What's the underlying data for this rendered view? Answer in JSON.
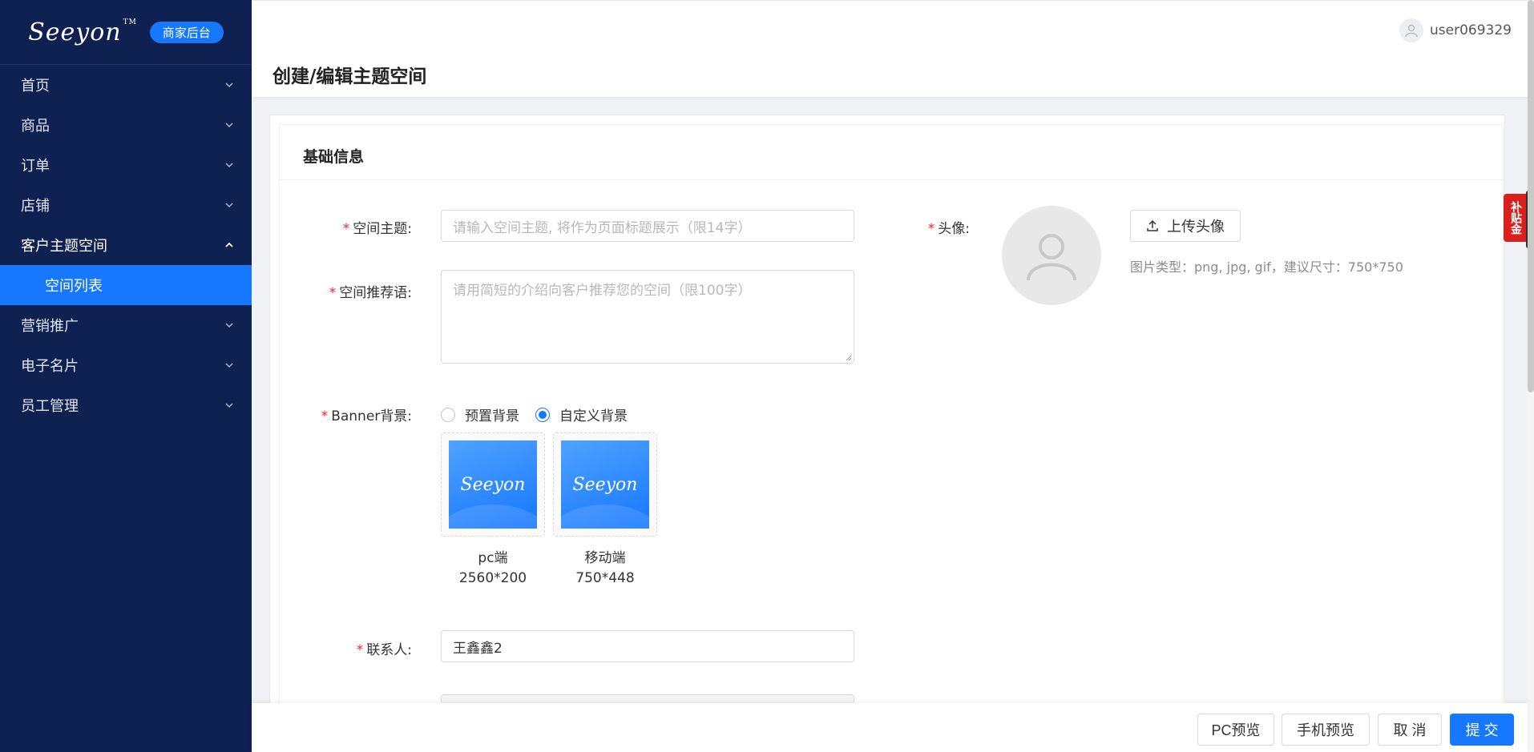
{
  "sidebar": {
    "logo": "Seeyon",
    "logo_tm": "TM",
    "badge": "商家后台",
    "items": [
      {
        "label": "首页"
      },
      {
        "label": "商品"
      },
      {
        "label": "订单"
      },
      {
        "label": "店铺"
      },
      {
        "label": "客户主题空间"
      },
      {
        "label": "营销推广"
      },
      {
        "label": "电子名片"
      },
      {
        "label": "员工管理"
      }
    ],
    "active_sub": "空间列表"
  },
  "header": {
    "title": "创建/编辑主题空间",
    "username": "user069329"
  },
  "side_tag": "补贴金",
  "form": {
    "section_title": "基础信息",
    "theme_label": "空间主题:",
    "theme_placeholder": "请输入空间主题, 将作为页面标题展示（限14字）",
    "recommend_label": "空间推荐语:",
    "recommend_placeholder": "请用简短的介绍向客户推荐您的空间（限100字）",
    "banner_label": "Banner背景:",
    "banner_options": [
      "预置背景",
      "自定义背景"
    ],
    "banner_selected": "自定义背景",
    "thumbs": [
      {
        "logo": "Seeyon",
        "name": "pc端",
        "size": "2560*200"
      },
      {
        "logo": "Seeyon",
        "name": "移动端",
        "size": "750*448"
      }
    ],
    "contact_label": "联系人:",
    "contact_value": "王鑫鑫2",
    "avatar_label": "头像:",
    "upload_label": "上传头像",
    "upload_hint": "图片类型：png, jpg, gif，建议尺寸：750*750"
  },
  "footer": {
    "pc_preview": "PC预览",
    "mobile_preview": "手机预览",
    "cancel": "取 消",
    "submit": "提 交"
  },
  "colors": {
    "sidebar_bg": "#0e2150",
    "accent": "#1677ff",
    "required": "#f5222d"
  }
}
